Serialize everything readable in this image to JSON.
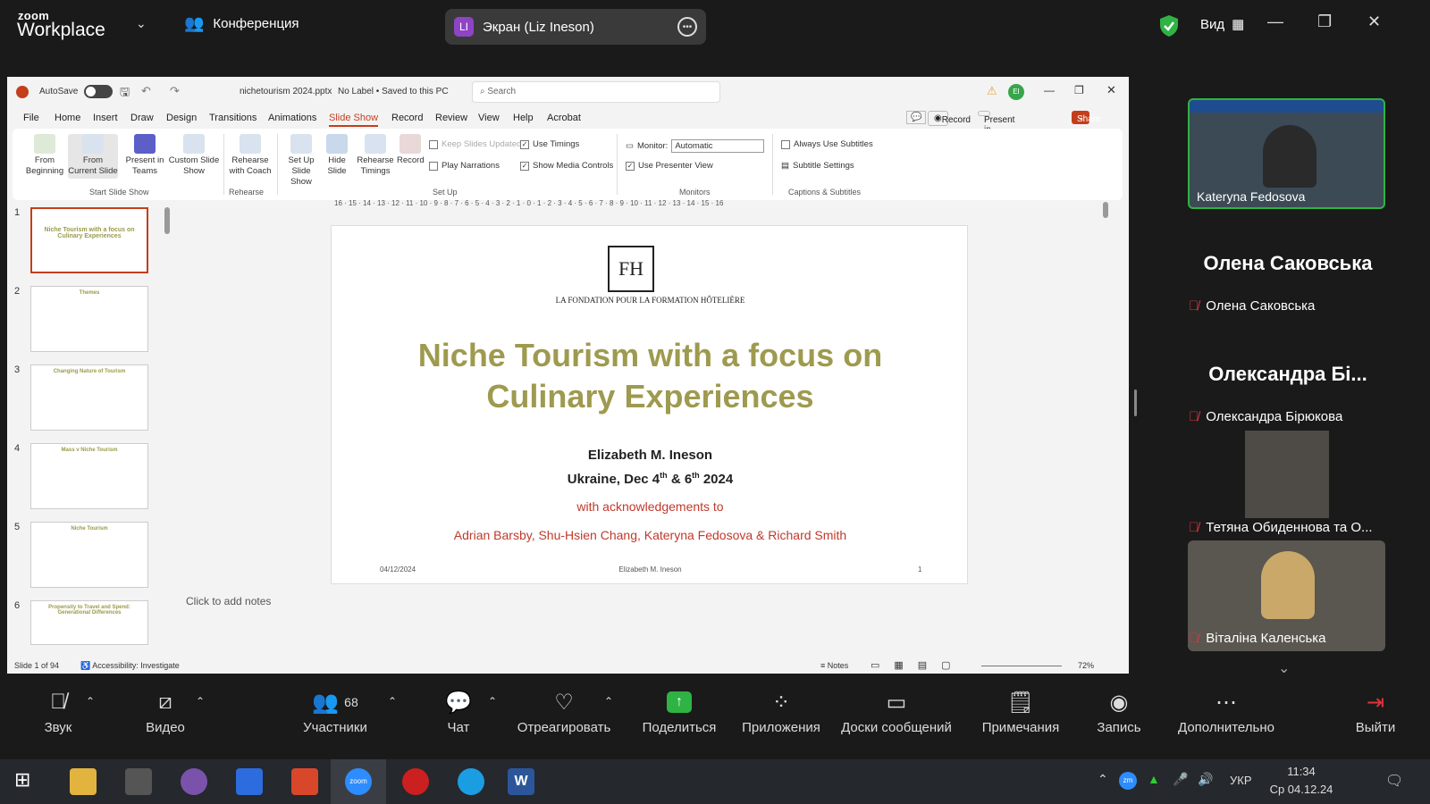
{
  "zoom": {
    "logo_top": "zoom",
    "logo_bottom": "Workplace",
    "meeting": "Конференция",
    "share_initial": "LI",
    "share_label": "Экран (Liz Ineson)",
    "view": "Вид"
  },
  "ppt": {
    "autosave": "AutoSave",
    "filename": "nichetourism 2024.pptx",
    "label": "No Label • Saved to this PC",
    "search": "Search",
    "avatar": "EI",
    "tabs": [
      "File",
      "Home",
      "Insert",
      "Draw",
      "Design",
      "Transitions",
      "Animations",
      "Slide Show",
      "Record",
      "Review",
      "View",
      "Help",
      "Acrobat"
    ],
    "record_btn": "Record",
    "present_teams": "Present in Teams",
    "share": "Share",
    "ribbon": {
      "from_beginning": "From Beginning",
      "from_current": "From Current Slide",
      "present_teams": "Present in Teams",
      "custom": "Custom Slide Show",
      "rehearse_coach": "Rehearse with Coach",
      "setup": "Set Up Slide Show",
      "hide": "Hide Slide",
      "rehearse_timings": "Rehearse Timings",
      "record": "Record",
      "keep_slides": "Keep Slides Updated",
      "use_timings": "Use Timings",
      "play_narr": "Play Narrations",
      "show_media": "Show Media Controls",
      "monitor_label": "Monitor:",
      "monitor_val": "Automatic",
      "presenter_view": "Use Presenter View",
      "always_sub": "Always Use Subtitles",
      "subtitle_settings": "Subtitle Settings",
      "grp_start": "Start Slide Show",
      "grp_rehearse": "Rehearse",
      "grp_setup": "Set Up",
      "grp_monitors": "Monitors",
      "grp_captions": "Captions & Subtitles"
    },
    "thumb_nums": [
      "1",
      "2",
      "3",
      "4",
      "5",
      "6"
    ],
    "thumb_titles": [
      "Niche Tourism with a focus on Culinary Experiences",
      "Themes",
      "Changing Nature of Tourism",
      "Mass v Niche Tourism",
      "Niche Tourism",
      "Propensity to Travel and Spend: Generational Differences"
    ],
    "slide": {
      "logo": "FH",
      "org": "LA FONDATION POUR LA FORMATION HÔTELIÈRE",
      "title1": "Niche Tourism with a focus on",
      "title2": "Culinary Experiences",
      "author": "Elizabeth M. Ineson",
      "place_pre": "Ukraine, Dec 4",
      "sup1": "th",
      "place_mid": " & 6",
      "sup2": "th",
      "place_post": " 2024",
      "ack": "with acknowledgements to",
      "names": "Adrian Barsby, Shu-Hsien Chang, Kateryna Fedosova & Richard Smith",
      "f_date": "04/12/2024",
      "f_author": "Elizabeth M. Ineson",
      "f_num": "1"
    },
    "ruler": "16 · 15 · 14 · 13 · 12 · 11 · 10 · 9 · 8 · 7 · 6 · 5 · 4 · 3 · 2 · 1 · 0 · 1 · 2 · 3 · 4 · 5 · 6 · 7 · 8 · 9 · 10 · 11 · 12 · 13 · 14 · 15 · 16",
    "notes": "Click to add notes",
    "status": {
      "slide": "Slide 1 of 94",
      "access": "Accessibility: Investigate",
      "notes": "Notes",
      "zoom": "72%"
    }
  },
  "participants": {
    "p1": "Kateryna Fedosova",
    "p2_big": "Олена Саковська",
    "p2": "Олена Саковська",
    "p3_big": "Олександра Бі...",
    "p3": "Олександра Бірюкова",
    "p4": "Тетяна Обиденнова та О...",
    "p5": "Віталіна Каленська"
  },
  "toolbar": {
    "audio": "Звук",
    "video": "Видео",
    "participants": "Участники",
    "count": "68",
    "chat": "Чат",
    "react": "Отреагировать",
    "share": "Поделиться",
    "apps": "Приложения",
    "boards": "Доски сообщений",
    "notes": "Примечания",
    "record": "Запись",
    "more": "Дополнительно",
    "leave": "Выйти"
  },
  "taskbar": {
    "lang": "УКР",
    "time": "11:34",
    "date": "Ср 04.12.24",
    "zm": "zm"
  }
}
